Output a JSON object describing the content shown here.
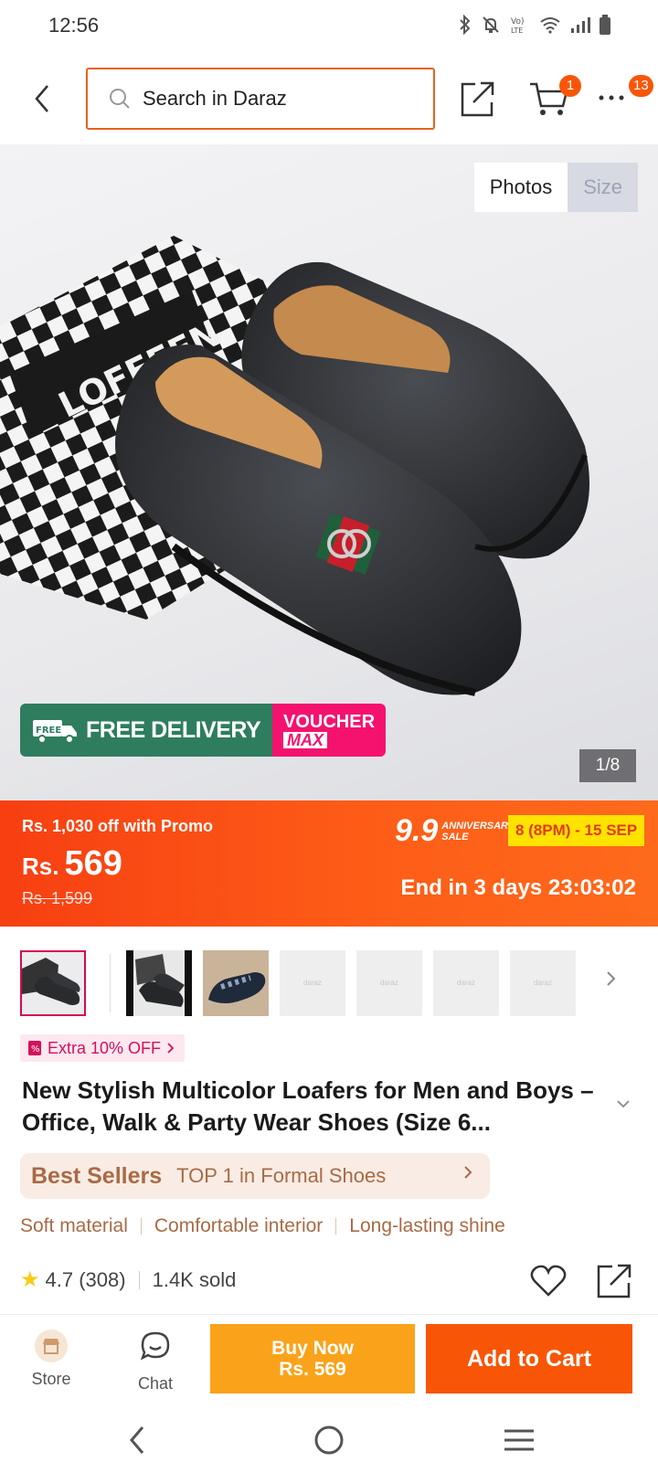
{
  "status_bar": {
    "time": "12:56"
  },
  "top_nav": {
    "search_placeholder": "Search in Daraz",
    "cart_count": "1",
    "more_count": "13"
  },
  "gallery": {
    "tabs": [
      "Photos",
      "Size"
    ],
    "active_tab": "Photos",
    "counter": "1/8",
    "promo_free_delivery": "FREE DELIVERY",
    "promo_free_small": "FREE",
    "promo_voucher_line1": "VOUCHER",
    "promo_voucher_line2": "MAX",
    "box_label": "LOFFEEN"
  },
  "price": {
    "promo_off": "Rs. 1,030 off with Promo",
    "currency": "Rs.",
    "amount": "569",
    "original": "Rs. 1,599",
    "sale_big": "9.9",
    "sale_small_1": "ANNIVERSARY",
    "sale_small_2": "SALE",
    "sale_dates": "8 (8PM) - 15 SEP",
    "countdown": "End in 3 days 23:03:02"
  },
  "thumbnails": {
    "placeholder_text": "daraz",
    "count_shown": 7
  },
  "extra_tag": "Extra 10% OFF",
  "product": {
    "title": "New Stylish Multicolor Loafers for Men and Boys – Office, Walk & Party Wear Shoes (Size 6..."
  },
  "best_sellers": {
    "brand": "Best Sellers",
    "text": "TOP 1 in Formal Shoes"
  },
  "features": [
    "Soft material",
    "Comfortable interior",
    "Long-lasting shine"
  ],
  "rating": {
    "score": "4.7",
    "count": "(308)",
    "sold": "1.4K sold"
  },
  "bottom_bar": {
    "store_label": "Store",
    "chat_label": "Chat",
    "buy_now_label": "Buy Now",
    "buy_now_price": "Rs. 569",
    "add_to_cart_label": "Add to Cart"
  },
  "colors": {
    "brand_orange": "#f85606",
    "buy_now": "#faa21a",
    "free_delivery": "#2e7d5f",
    "voucher_pink": "#f5126f",
    "best_sellers_text": "#a96a45"
  }
}
